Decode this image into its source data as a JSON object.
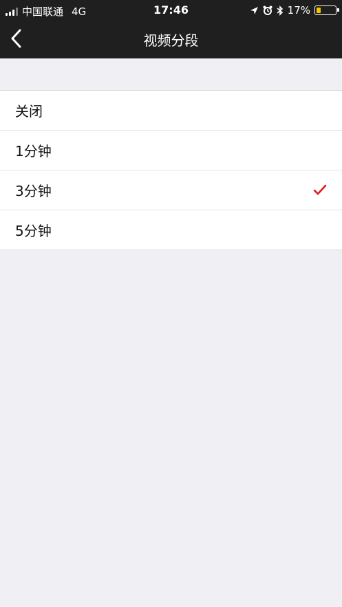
{
  "status_bar": {
    "carrier": "中国联通",
    "network": "4G",
    "time": "17:46",
    "battery_percent": "17%",
    "battery_level": 0.17,
    "icons": [
      "signal-icon",
      "location-arrow-icon",
      "alarm-icon",
      "bluetooth-icon",
      "battery-icon"
    ]
  },
  "navbar": {
    "title": "视频分段",
    "back_icon": "chevron-left-icon"
  },
  "options": [
    {
      "label": "关闭",
      "selected": false
    },
    {
      "label": "1分钟",
      "selected": false
    },
    {
      "label": "3分钟",
      "selected": true
    },
    {
      "label": "5分钟",
      "selected": false
    }
  ],
  "colors": {
    "header_bg": "#1f1f1f",
    "page_bg": "#efeff4",
    "check": "#e0141e",
    "battery_fill": "#f5c400"
  }
}
